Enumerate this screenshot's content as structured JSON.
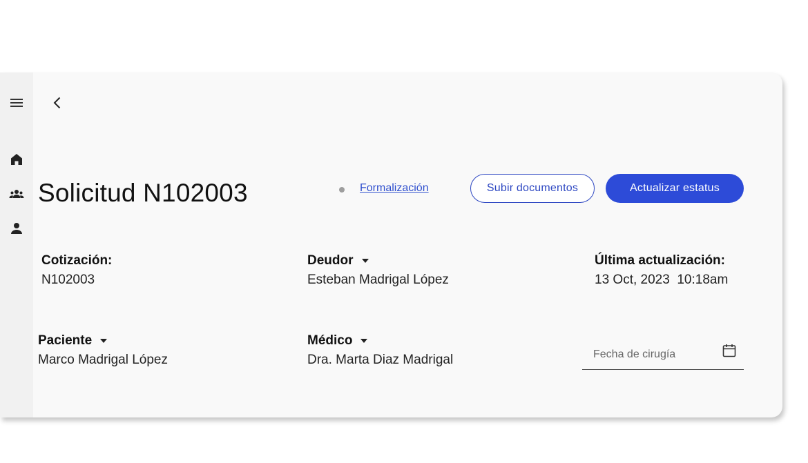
{
  "sidebar": {
    "items": [
      {
        "name": "menu",
        "icon": "menu-icon"
      },
      {
        "name": "home",
        "icon": "home-icon"
      },
      {
        "name": "groups",
        "icon": "groups-icon"
      },
      {
        "name": "person",
        "icon": "person-icon"
      }
    ]
  },
  "header": {
    "back_icon": "chevron-left-icon",
    "title": "Solicitud N102003",
    "status_label": "Formalización",
    "upload_button": "Subir documentos",
    "update_button": "Actualizar estatus"
  },
  "details": {
    "cotizacion": {
      "label": "Cotización:",
      "value": "N102003"
    },
    "deudor": {
      "label": "Deudor",
      "value": "Esteban Madrigal López"
    },
    "ultima": {
      "label": "Última actualización:",
      "value": "13 Oct, 2023  10:18am"
    },
    "paciente": {
      "label": "Paciente",
      "value": "Marco Madrigal López"
    },
    "medico": {
      "label": "Médico",
      "value": "Dra. Marta Diaz Madrigal"
    },
    "fecha_cirugia": {
      "placeholder": "Fecha de cirugía",
      "icon": "calendar-icon"
    }
  },
  "colors": {
    "primary": "#2d4bd8",
    "link": "#2f4fce",
    "status_dot": "#9e9e9e",
    "card_bg": "#f9f9f9",
    "rail_bg": "#f1f1f1"
  }
}
